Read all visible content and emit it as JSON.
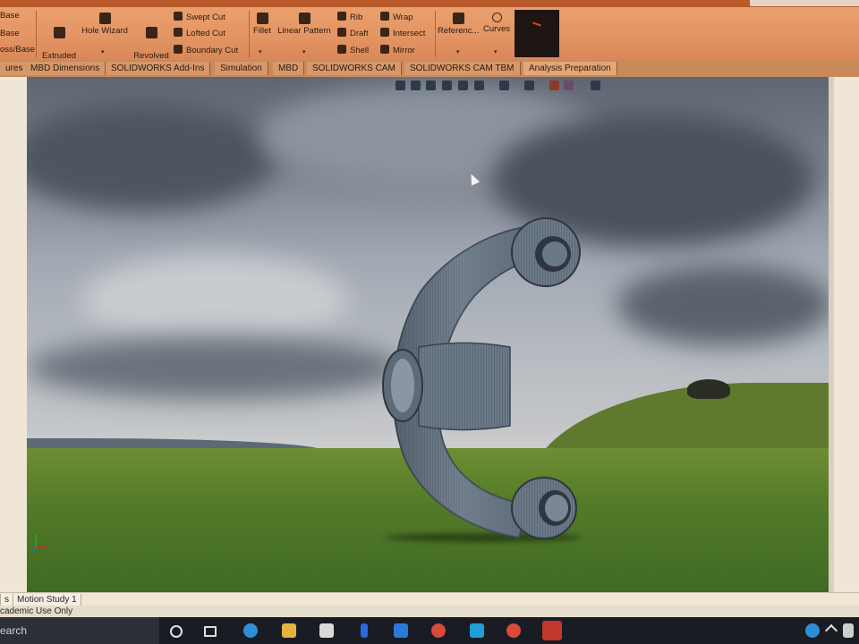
{
  "ribbon": {
    "partial_left": [
      "Base",
      "Base",
      "oss/Base"
    ],
    "extruded_cut": "Extruded\nCut",
    "hole_wizard": "Hole Wizard",
    "revolved_cut": "Revolved\nCut",
    "swept_cut": "Swept Cut",
    "lofted_cut": "Lofted Cut",
    "boundary_cut": "Boundary Cut",
    "fillet": "Fillet",
    "linear_pattern": "Linear Pattern",
    "rib": "Rib",
    "draft": "Draft",
    "shell": "Shell",
    "wrap": "Wrap",
    "intersect": "Intersect",
    "mirror": "Mirror",
    "reference": "Referenc...",
    "curves": "Curves"
  },
  "tabs": [
    "ures",
    "MBD Dimensions",
    "SOLIDWORKS Add-Ins",
    "Simulation",
    "MBD",
    "SOLIDWORKS CAM",
    "SOLIDWORKS CAM TBM",
    "Analysis Preparation"
  ],
  "bottom_tabs": [
    "s",
    "Motion Study 1"
  ],
  "status": {
    "text": "cademic Use Only"
  },
  "taskbar": {
    "search_text": "earch",
    "apps": [
      "cortana-circle",
      "task-view",
      "edge",
      "file-explorer",
      "store",
      "power-automate",
      "mail",
      "chrome",
      "instagram-app",
      "chrome-2",
      "solidworks"
    ]
  },
  "colors": {
    "ribbon": "#e39463",
    "tabs": "#c98a5a",
    "part": "#5d6a78"
  }
}
